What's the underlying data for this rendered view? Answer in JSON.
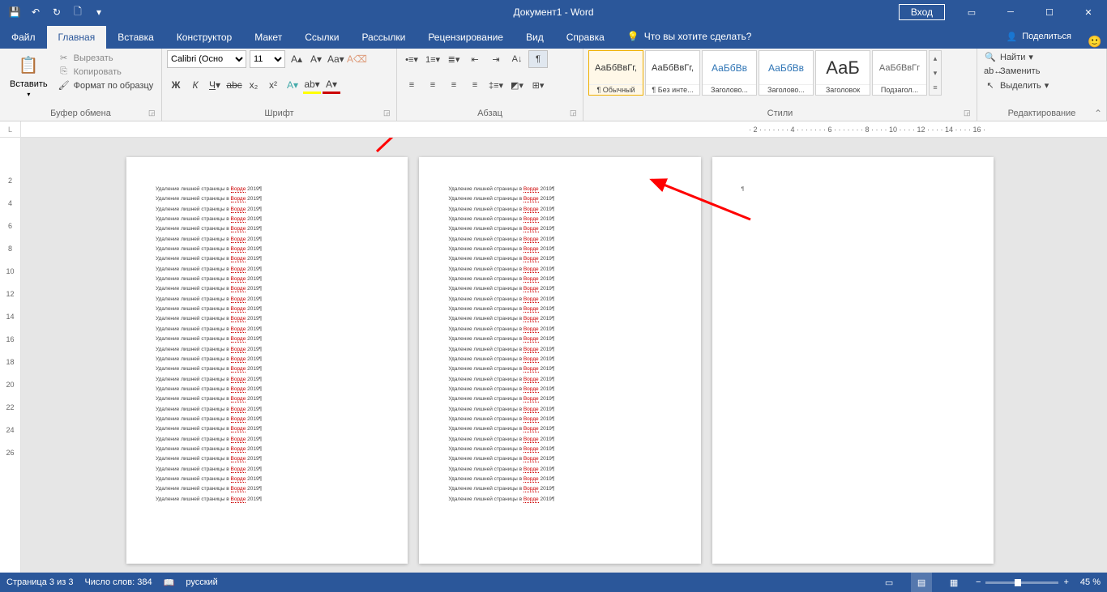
{
  "titlebar": {
    "title": "Документ1 - Word",
    "signin": "Вход",
    "qa": {
      "save": "💾",
      "undo": "↶",
      "redo": "↻",
      "new": "🗋",
      "custom": "▾"
    }
  },
  "tabs": {
    "file": "Файл",
    "home": "Главная",
    "insert": "Вставка",
    "design": "Конструктор",
    "layout": "Макет",
    "references": "Ссылки",
    "mailings": "Рассылки",
    "review": "Рецензирование",
    "view": "Вид",
    "help": "Справка",
    "tell": "Что вы хотите сделать?",
    "share": "Поделиться"
  },
  "ribbon": {
    "clipboard": {
      "label": "Буфер обмена",
      "paste": "Вставить",
      "cut": "Вырезать",
      "copy": "Копировать",
      "format_painter": "Формат по образцу"
    },
    "font": {
      "label": "Шрифт",
      "fontname": "Calibri (Осно",
      "fontsize": "11"
    },
    "paragraph": {
      "label": "Абзац"
    },
    "styles": {
      "label": "Стили",
      "items": [
        {
          "preview": "АаБбВвГг,",
          "name": "¶ Обычный"
        },
        {
          "preview": "АаБбВвГг,",
          "name": "¶ Без инте..."
        },
        {
          "preview": "АаБбВв",
          "name": "Заголово..."
        },
        {
          "preview": "АаБбВв",
          "name": "Заголово..."
        },
        {
          "preview": "АаБ",
          "name": "Заголовок"
        },
        {
          "preview": "АаБбВвГг",
          "name": "Подзагол..."
        }
      ]
    },
    "editing": {
      "label": "Редактирование",
      "find": "Найти",
      "replace": "Заменить",
      "select": "Выделить"
    }
  },
  "document": {
    "line_prefix": "Удаление лишней страницы в ",
    "line_err": "Ворде",
    "line_suffix": " 2019¶",
    "lines_per_page": 32,
    "page3_mark": "¶"
  },
  "vruler": {
    "ticks": [
      "",
      "2",
      "4",
      "6",
      "8",
      "10",
      "12",
      "14",
      "16",
      "18",
      "20",
      "22",
      "24",
      "26",
      ""
    ]
  },
  "hruler": {
    "text": "· 2 · · · · · · · 4 · · · · · · · 6 · · · · · · · 8 · · · · 10 · · · · 12 · · · · 14 · · · · 16 ·"
  },
  "statusbar": {
    "page": "Страница 3 из 3",
    "words": "Число слов: 384",
    "lang": "русский",
    "zoom": "45 %"
  }
}
